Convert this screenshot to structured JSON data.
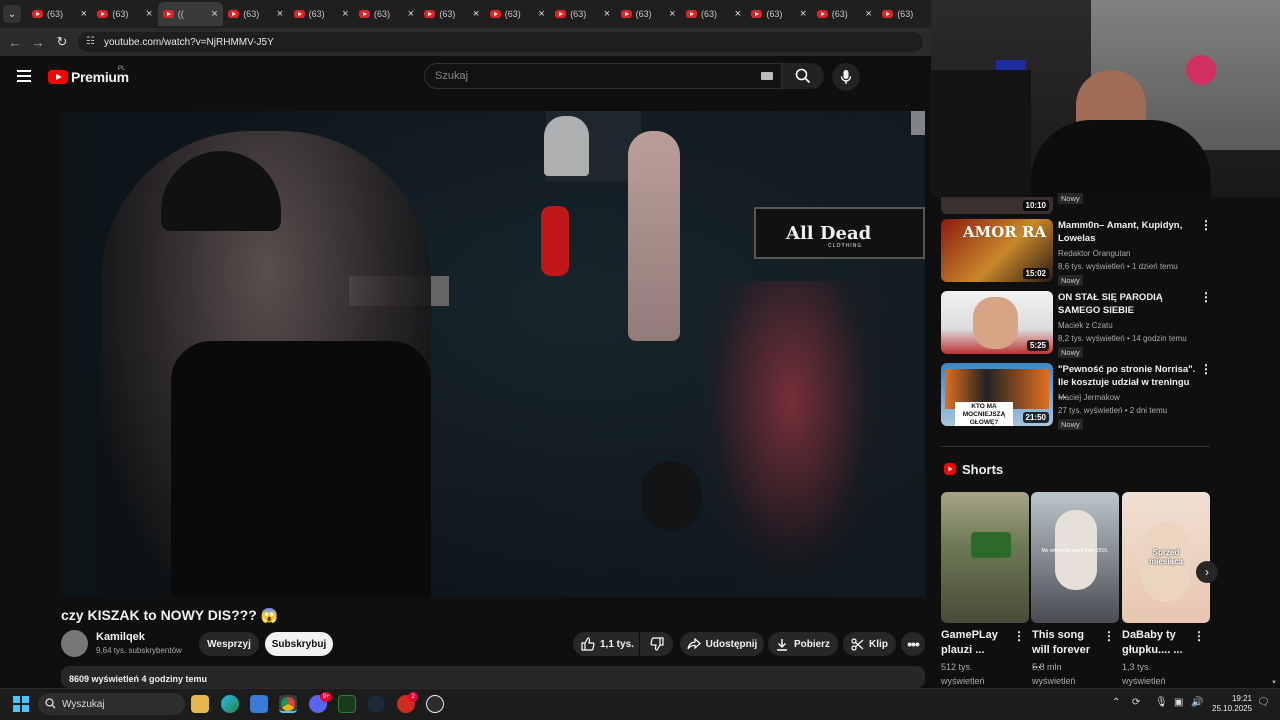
{
  "browser": {
    "tabs": [
      {
        "label": "(63)"
      },
      {
        "label": "(63)"
      },
      {
        "label": "(("
      },
      {
        "label": "(63)"
      },
      {
        "label": "(63)"
      },
      {
        "label": "(63)"
      },
      {
        "label": "(63)"
      },
      {
        "label": "(63)"
      },
      {
        "label": "(63)"
      },
      {
        "label": "(63)"
      },
      {
        "label": "(63)"
      },
      {
        "label": "(63)"
      },
      {
        "label": "(63)"
      },
      {
        "label": "(63)"
      }
    ],
    "active_tab_index": 2,
    "url": "youtube.com/watch?v=NjRHMMV-J5Y"
  },
  "youtube": {
    "logo_text": "Premium",
    "logo_region": "PL",
    "search_placeholder": "Szukaj"
  },
  "video": {
    "brand_overlay": "All Dead",
    "brand_sub": "CLOTHING",
    "title": "czy KISZAK to NOWY DIS??? 😱",
    "channel": "Kamilqek",
    "subscribers": "9,64 tys. subskrybentów",
    "support_label": "Wesprzyj",
    "subscribe_label": "Subskrybuj",
    "likes": "1,1 tys.",
    "share_label": "Udostępnij",
    "download_label": "Pobierz",
    "clip_label": "Klip",
    "views_line": "8609 wyświetleń  4 godziny temu"
  },
  "sidebar": {
    "partial_duration": "10:10",
    "partial_badge": "Nowy",
    "videos": [
      {
        "title": "Mamm0n– Amant, Kupidyn, Lowelas",
        "channel": "Redaktor Orangutan",
        "meta": "8,6 tys. wyświetleń • 1 dzień temu",
        "badge": "Nowy",
        "duration": "15:02"
      },
      {
        "title": "ON STAŁ SIĘ PARODIĄ SAMEGO SIEBIE",
        "channel": "Maciek z Czatu",
        "meta": "8,2 tys. wyświetleń • 14 godzin temu",
        "badge": "Nowy",
        "duration": "5:25"
      },
      {
        "title": "\"Pewność po stronie Norrisa\". Ile kosztuje udział w treningu ...",
        "channel": "Maciej Jermakow",
        "meta": "27 tys. wyświetleń • 2 dni temu",
        "badge": "Nowy",
        "duration": "21:50"
      }
    ],
    "thumb_text": {
      "amor": "AMOR RA",
      "mocniejsza": "KTO MA MOCNIEJSZĄ GŁOWĘ?"
    },
    "shorts_title": "Shorts",
    "shorts": [
      {
        "title": "GamePLay plauzi ...",
        "views": "512 tys. wyświetleń"
      },
      {
        "title": "This song will forever ...",
        "views": "5,8 mln wyświetleń",
        "overlay": "Me when this song from 2016."
      },
      {
        "title": "DaBaby ty głupku.... ...",
        "views": "1,3 tys. wyświetleń",
        "overlay": "Sprzed miesiąca"
      }
    ]
  },
  "taskbar": {
    "search_label": "Wyszukaj",
    "time": "19:21",
    "date": "25.10.2025",
    "discord_badge": "9+",
    "opera_badge": "2"
  }
}
